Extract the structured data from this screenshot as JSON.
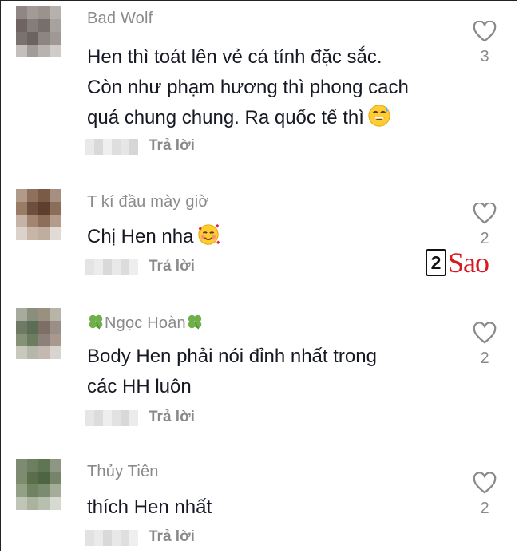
{
  "comments": [
    {
      "username": "Bad Wolf",
      "lines": [
        "Hen thì toát lên vẻ cá tính đặc sắc.",
        "Còn như phạm hương thì phong cach",
        "quá chung chung. Ra quốc tế thì"
      ],
      "reply_label": "Trả lời",
      "like_count": "3",
      "emoji": "sweat-smile-emoji",
      "avatar_colors": [
        "#8f8783",
        "#a19a96",
        "#9c928d",
        "#b7b1ae",
        "#6f6460",
        "#857d79",
        "#75706c",
        "#a8a29f",
        "#7b726e",
        "#6c625f",
        "#8c8582",
        "#9f9894",
        "#c4bfbc",
        "#a29b97",
        "#b9b3b0",
        "#d0ccca"
      ]
    },
    {
      "username": "T kí đầu mày giờ",
      "lines": [
        "Chị Hen nha"
      ],
      "reply_label": "Trả lời",
      "like_count": "2",
      "emoji": "smiling-face-with-hearts-emoji",
      "avatar_colors": [
        "#b09a8a",
        "#8f705c",
        "#7a5b46",
        "#a58f80",
        "#9a7b64",
        "#6e4f3b",
        "#5c3f2d",
        "#8b6e5a",
        "#c4b3a6",
        "#a48670",
        "#8d6e58",
        "#b39c8b",
        "#dcd2ca",
        "#c7b6a8",
        "#bfae9f",
        "#e2dad4"
      ]
    },
    {
      "username": "Ngọc Hoàn",
      "lines": [
        "Body Hen phải nói đỉnh nhất trong",
        "các HH luôn"
      ],
      "reply_label": "Trả lời",
      "like_count": "2",
      "emoji": "four-leaf-clover-icon",
      "avatar_colors": [
        "#a7ab9d",
        "#8a8f7d",
        "#99907f",
        "#b8b4a8",
        "#6f7a66",
        "#5d6c54",
        "#7d6f66",
        "#9a8f86",
        "#879177",
        "#6b7c5f",
        "#8d807a",
        "#a8998f",
        "#c7c9bd",
        "#b5b8a9",
        "#c4b9b1",
        "#d9d4cf"
      ]
    },
    {
      "username": "Thủy Tiên",
      "lines": [
        "thích Hen nhất"
      ],
      "reply_label": "Trả lời",
      "like_count": "2",
      "emoji": "",
      "avatar_colors": [
        "#7f8a74",
        "#6d7f5f",
        "#5f7553",
        "#8e9784",
        "#7d8c6c",
        "#5a6e4c",
        "#4e6544",
        "#76856a",
        "#93a085",
        "#6f8262",
        "#7a8b6f",
        "#a5ad9a",
        "#c0c6b7",
        "#a9b39d",
        "#b7bfae",
        "#d6dad0"
      ]
    }
  ],
  "watermark": {
    "number": "2",
    "text": "Sao"
  }
}
